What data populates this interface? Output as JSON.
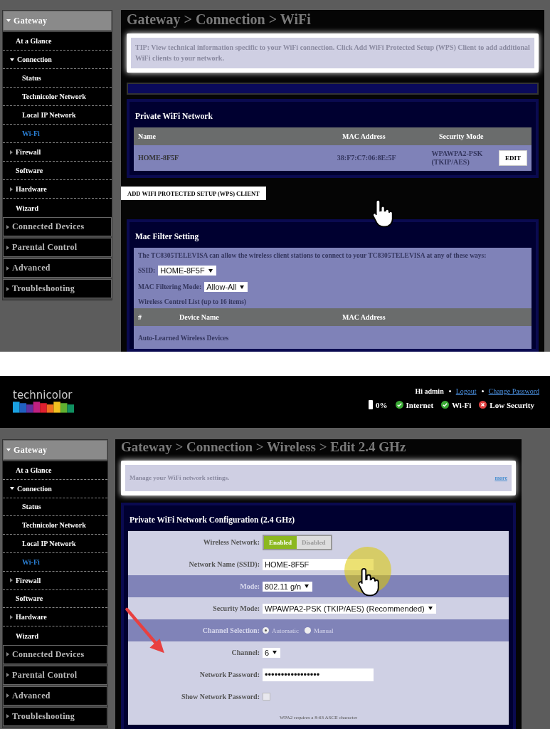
{
  "top_screen": {
    "sidebar": {
      "items": [
        {
          "label": "Gateway",
          "expanded": true,
          "selected": false,
          "children": [
            {
              "label": "At a Glance",
              "selected": false
            },
            {
              "label": "Connection",
              "expanded": true,
              "selected": false,
              "children": [
                {
                  "label": "Status",
                  "selected": false
                },
                {
                  "label": "Technicolor Network",
                  "selected": false
                },
                {
                  "label": "Local IP Network",
                  "selected": false
                },
                {
                  "label": "Wi-Fi",
                  "selected": true
                }
              ]
            },
            {
              "label": "Firewall",
              "expanded": false,
              "selected": false
            },
            {
              "label": "Software",
              "selected": false
            },
            {
              "label": "Hardware",
              "expanded": false,
              "selected": false
            },
            {
              "label": "Wizard",
              "selected": false
            }
          ]
        },
        {
          "label": "Connected Devices",
          "expanded": false,
          "selected": false
        },
        {
          "label": "Parental Control",
          "expanded": false,
          "selected": false
        },
        {
          "label": "Advanced",
          "expanded": false,
          "selected": false
        },
        {
          "label": "Troubleshooting",
          "expanded": false,
          "selected": false
        }
      ]
    },
    "title": "Gateway > Connection > WiFi",
    "tip": "TIP: View technical information specific to your WiFi connection. Click Add WiFi Protected Setup (WPS) Client to add additional WiFi clients to your network.",
    "wifi_card": {
      "title": "Private WiFi Network",
      "columns": [
        "Name",
        "MAC Address",
        "Security Mode"
      ],
      "rows": [
        {
          "name": "HOME-8F5F",
          "mac": "38:F7:C7:06:8E:5F",
          "security": "WPAWPA2-PSK (TKIP/AES)",
          "action": "EDIT"
        }
      ]
    },
    "wps_button": "ADD WIFI PROTECTED SETUP (WPS) CLIENT",
    "mac_card": {
      "title": "Mac Filter Setting",
      "description": "The TC8305TELEVISA can allow the wireless client stations to connect to your TC8305TELEVISA at any of these ways:",
      "fields": [
        {
          "label": "SSID:",
          "value": "HOME-8F5F"
        },
        {
          "label": "MAC Filtering Mode:",
          "value": "Allow-All"
        }
      ],
      "list_caption": "Wireless Control List (up to 16 items)",
      "columns": [
        "#",
        "Device Name",
        "MAC Address"
      ],
      "footer": "Auto-Learned Wireless Devices"
    }
  },
  "bottom_screen": {
    "brand": "technicolor",
    "greeting": "Hi admin",
    "links": [
      "Logout",
      "Change Password"
    ],
    "battery": "0%",
    "status": [
      {
        "label": "Internet",
        "kind": "ok"
      },
      {
        "label": "Wi-Fi",
        "kind": "ok"
      },
      {
        "label": "Low Security",
        "kind": "error"
      }
    ],
    "sidebar": {
      "items": [
        {
          "label": "Gateway",
          "expanded": true,
          "selected": false,
          "children": [
            {
              "label": "At a Glance",
              "selected": false
            },
            {
              "label": "Connection",
              "expanded": true,
              "selected": false,
              "children": [
                {
                  "label": "Status",
                  "selected": false
                },
                {
                  "label": "Technicolor Network",
                  "selected": false
                },
                {
                  "label": "Local IP Network",
                  "selected": false
                },
                {
                  "label": "Wi-Fi",
                  "selected": true
                }
              ]
            },
            {
              "label": "Firewall",
              "expanded": false,
              "selected": false
            },
            {
              "label": "Software",
              "selected": false
            },
            {
              "label": "Hardware",
              "expanded": false,
              "selected": false
            },
            {
              "label": "Wizard",
              "selected": false
            }
          ]
        },
        {
          "label": "Connected Devices",
          "expanded": false,
          "selected": false
        },
        {
          "label": "Parental Control",
          "expanded": false,
          "selected": false
        },
        {
          "label": "Advanced",
          "expanded": false,
          "selected": false
        },
        {
          "label": "Troubleshooting",
          "expanded": false,
          "selected": false
        }
      ]
    },
    "title": "Gateway > Connection > Wireless > Edit 2.4 GHz",
    "tip": "Manage your WiFi network settings.",
    "tip_link": "more",
    "config_card": {
      "title": "Private WiFi Network Configuration (2.4 GHz)",
      "rows": [
        {
          "kind": "toggle",
          "label": "Wireless Network:",
          "disabled": false,
          "options": [
            {
              "label": "Enabled",
              "selected": true
            },
            {
              "label": "Disabled",
              "selected": false
            }
          ]
        },
        {
          "kind": "text",
          "label": "Network Name (SSID):",
          "disabled": false,
          "value": "HOME-8F5F"
        },
        {
          "kind": "select",
          "label": "Mode:",
          "disabled": true,
          "value": "802.11 g/n"
        },
        {
          "kind": "select",
          "label": "Security Mode:",
          "disabled": false,
          "value": "WPAWPA2-PSK (TKIP/AES) (Recommended)"
        },
        {
          "kind": "radio",
          "label": "Channel Selection:",
          "disabled": true,
          "options": [
            {
              "label": "Automatic",
              "selected": true
            },
            {
              "label": "Manual",
              "selected": false
            }
          ]
        },
        {
          "kind": "select",
          "label": "Channel:",
          "disabled": false,
          "value": "6"
        },
        {
          "kind": "password",
          "label": "Network Password:",
          "disabled": false,
          "value": "•••••••••••••••••"
        },
        {
          "kind": "checkbox",
          "label": "Show Network Password:",
          "disabled": false,
          "checked": false
        }
      ],
      "note": "WPA2 requires a 8-63 ASCII character"
    }
  }
}
